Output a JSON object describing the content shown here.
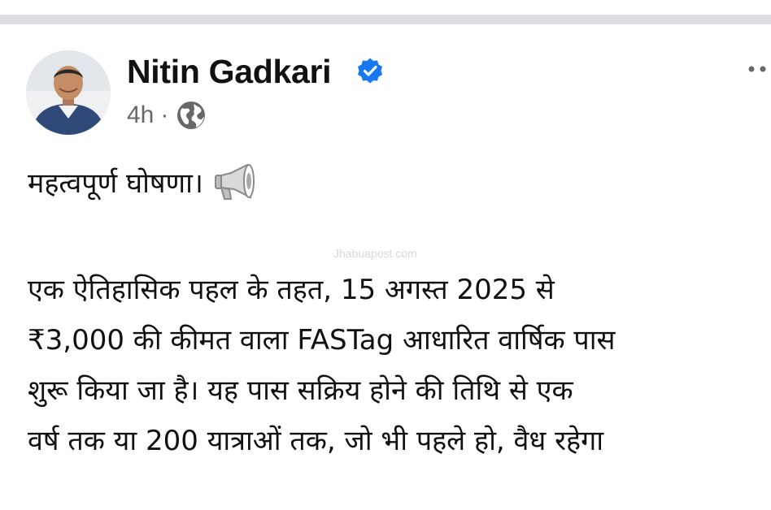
{
  "post": {
    "author": {
      "name": "Nitin Gadkari",
      "verified_icon": "verified-badge-icon",
      "avatar": "profile-photo"
    },
    "meta": {
      "time": "4h",
      "separator": "·",
      "privacy_icon": "globe-icon"
    },
    "more_icon": "more-options-icon",
    "heading": "महत्वपूर्ण घोषणा।",
    "heading_icon": "megaphone-icon",
    "watermark": "Jhabuapost.com",
    "body_lines": [
      "एक ऐतिहासिक पहल के तहत, 15 अगस्त 2025 से",
      "₹3,000 की कीमत वाला FASTag आधारित वार्षिक पास",
      "शुरू किया जा है। यह पास सक्रिय होने की तिथि से एक",
      "वर्ष तक या 200 यात्राओं तक, जो भी पहले हो, वैध रहेगा"
    ]
  },
  "colors": {
    "divider": "#dcdde1",
    "verified": "#1877f2",
    "meta_text": "#65676b",
    "text": "#111111"
  }
}
